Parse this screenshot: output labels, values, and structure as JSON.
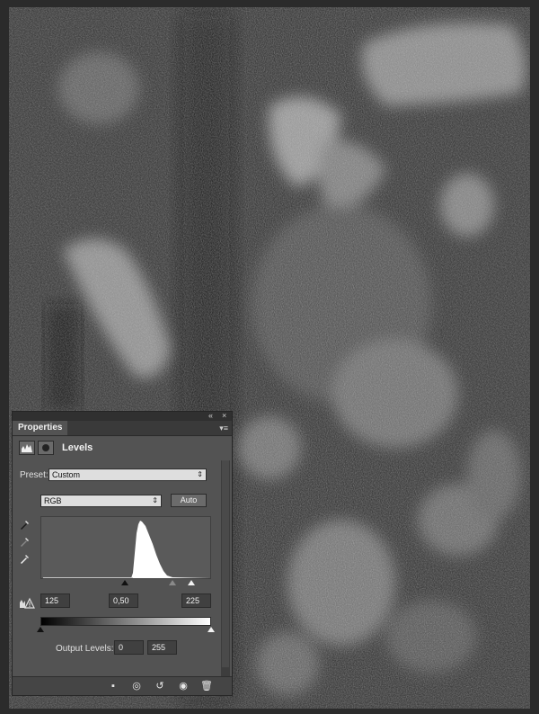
{
  "panel": {
    "tab_title": "Properties",
    "collapse_icon": "double-chevron-icon",
    "close_icon": "close-icon",
    "menu_icon": "panel-menu-icon",
    "adjustment_title": "Levels",
    "preset": {
      "label": "Preset:",
      "value": "Custom"
    },
    "channel": {
      "value": "RGB",
      "auto_label": "Auto"
    },
    "input_levels": {
      "black": "125",
      "gamma": "0,50",
      "white": "225"
    },
    "output_levels": {
      "label": "Output Levels:",
      "black": "0",
      "white": "255"
    },
    "bottom_icons": [
      "clip-to-layer-icon",
      "view-previous-state-icon",
      "reset-icon",
      "visibility-icon",
      "trash-icon"
    ]
  },
  "colors": {
    "panel_bg": "#535353",
    "canvas_bg": "#1f1f1f",
    "histogram_fill": "#ffffff"
  }
}
